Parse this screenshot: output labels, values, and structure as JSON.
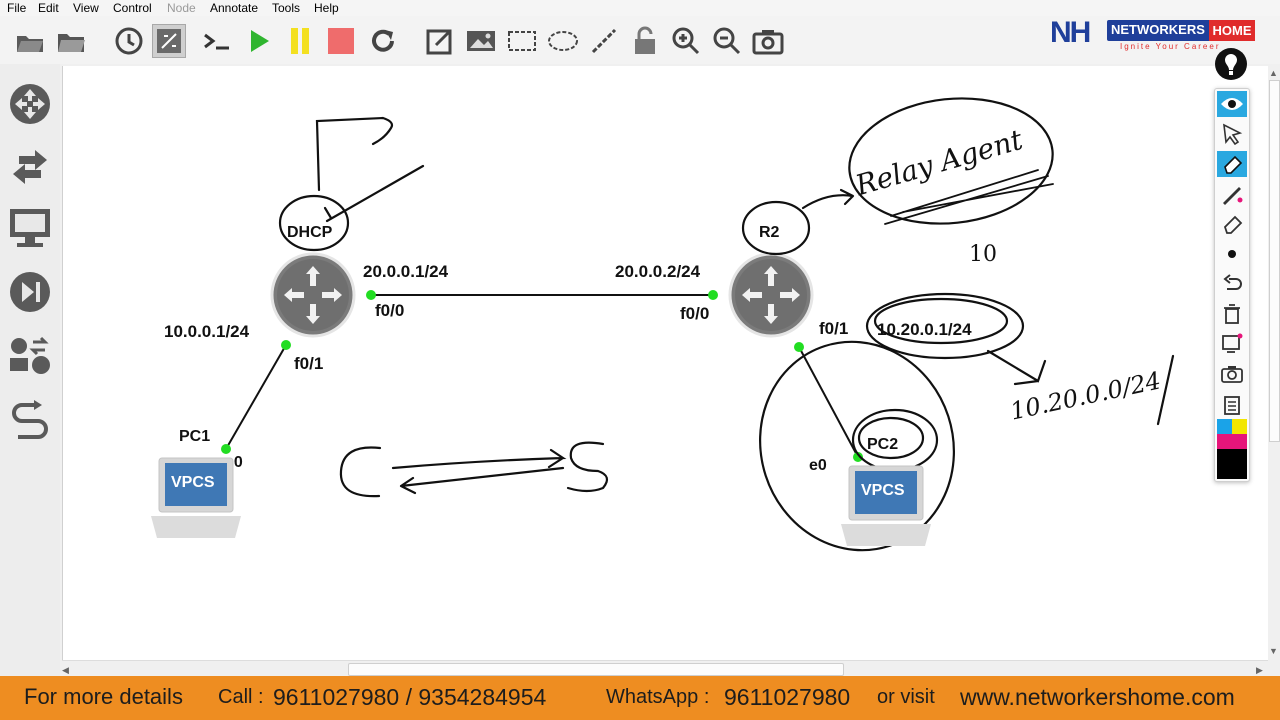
{
  "menu": [
    "File",
    "Edit",
    "View",
    "Control",
    "Node",
    "Annotate",
    "Tools",
    "Help"
  ],
  "menu_disabled": [
    "Node"
  ],
  "toolbar_icons": [
    "open-project-icon",
    "open-folder-icon",
    "snapshot-clock-icon",
    "show-interface-labels-icon",
    "console-icon",
    "start-icon",
    "pause-icon",
    "stop-icon",
    "reload-icon",
    "add-note-icon",
    "insert-picture-icon",
    "draw-rectangle-icon",
    "draw-ellipse-icon",
    "draw-line-icon",
    "lock-icon",
    "zoom-in-icon",
    "zoom-out-icon",
    "screenshot-icon"
  ],
  "brand": {
    "logo": "NH",
    "name": "NETWORKERS",
    "name_highlight": "HOME",
    "tagline": "Ignite Your Career"
  },
  "left_toolbar": [
    "browse-routers-icon",
    "browse-switches-icon",
    "browse-end-devices-icon",
    "browse-security-icon",
    "browse-all-devices-icon",
    "add-link-icon"
  ],
  "topology": {
    "routers": [
      {
        "id": "dhcp",
        "name": "DHCP"
      },
      {
        "id": "r2",
        "name": "R2"
      }
    ],
    "pcs": [
      {
        "id": "pc1",
        "name": "PC1",
        "badge": "VPCS",
        "port": "e0"
      },
      {
        "id": "pc2",
        "name": "PC2",
        "badge": "VPCS",
        "port": "e0"
      }
    ],
    "labels": {
      "dhcp_wan_ip": "20.0.0.1/24",
      "dhcp_wan_port": "f0/0",
      "dhcp_lan_ip": "10.0.0.1/24",
      "dhcp_lan_port": "f0/1",
      "r2_wan_ip": "20.0.0.2/24",
      "r2_wan_port": "f0/0",
      "r2_lan_port": "f0/1",
      "r2_lan_ip": "10.20.0.1/24"
    },
    "link_color": "#22dd22"
  },
  "annotations": {
    "relay": "Relay Agent",
    "ten": "10",
    "network": "10.20.0.0/24",
    "client_server": "C ⟷ S"
  },
  "palette_icons": [
    "eye-icon",
    "cursor-icon",
    "eraser-active-icon",
    "pen-icon",
    "eraser-icon",
    "dot-icon",
    "undo-icon",
    "trash-icon",
    "screen-capture-icon",
    "camera-icon",
    "clipboard-icon",
    "color-swatches"
  ],
  "palette_colors": [
    "#1aa3e8",
    "#f2e600",
    "#e6157a",
    "#000000"
  ],
  "footer": {
    "details": "For more details",
    "call_label": "Call :",
    "call_numbers": "9611027980 / 9354284954",
    "whatsapp_label": "WhatsApp :",
    "whatsapp_number": "9611027980",
    "visit_label": "or visit",
    "website": "www.networkershome.com"
  }
}
